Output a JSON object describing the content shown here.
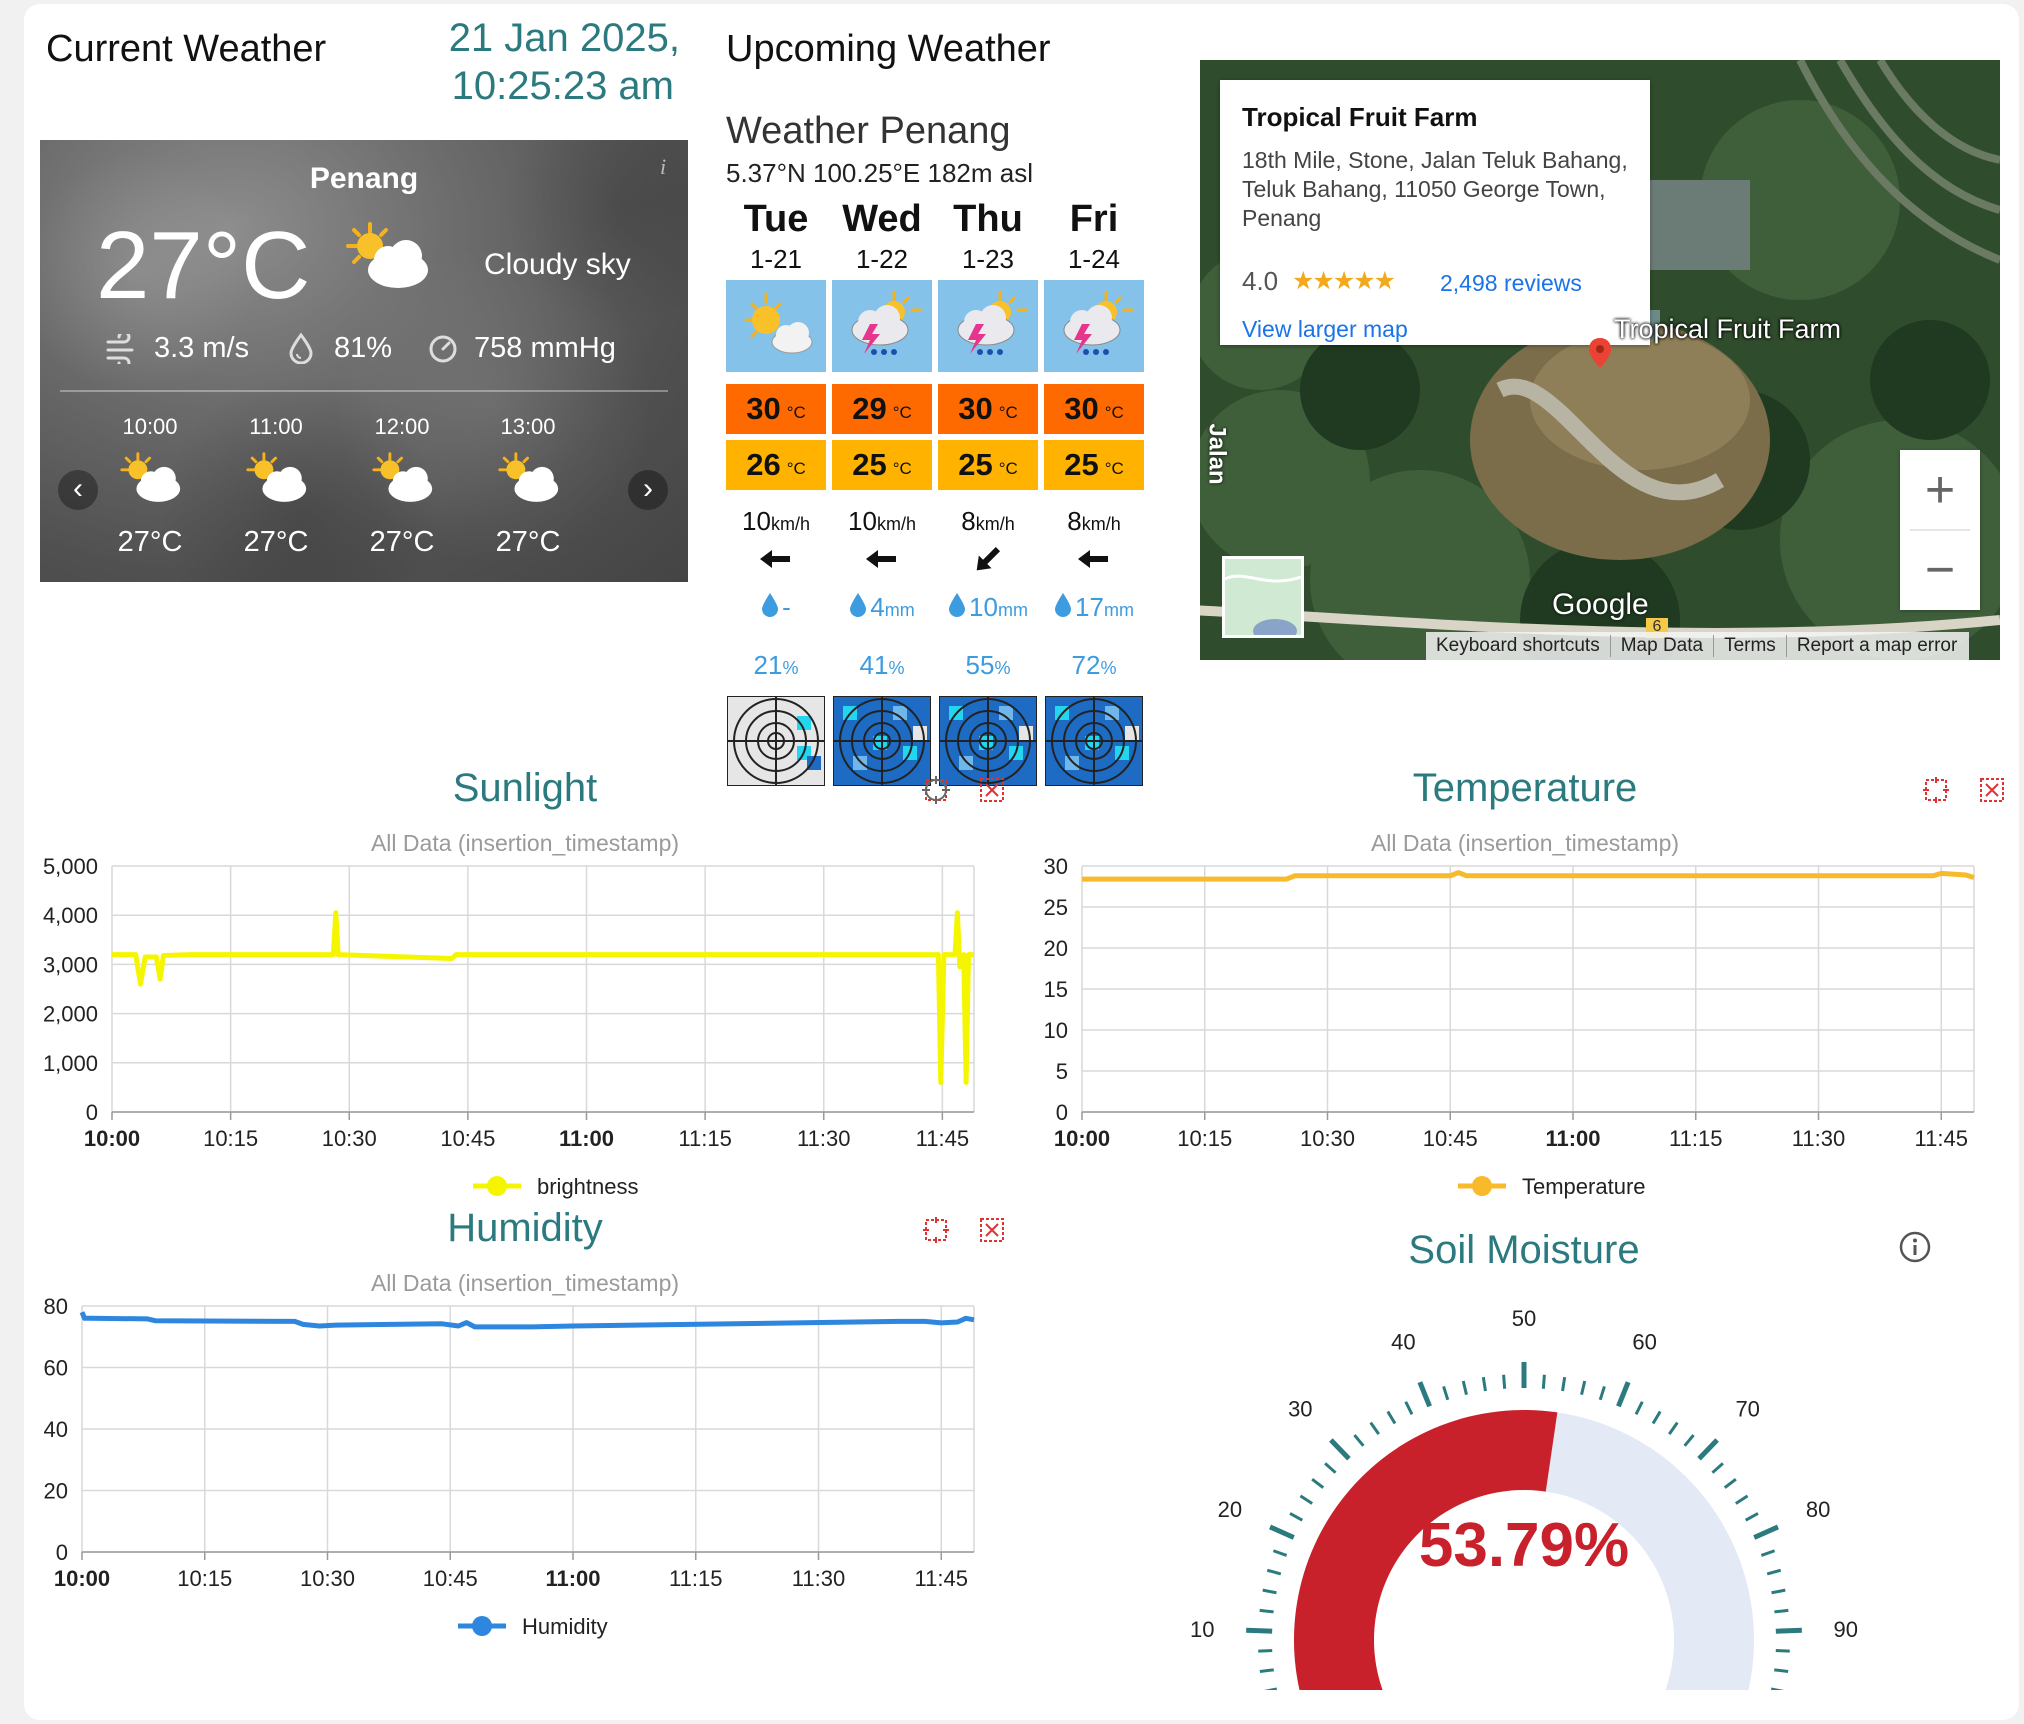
{
  "current": {
    "title": "Current Weather",
    "date_line1": "21 Jan 2025,",
    "date_line2": "10:25:23 am"
  },
  "widget": {
    "city": "Penang",
    "info": "i",
    "temp": "27°C",
    "condition": "Cloudy sky",
    "wind": "3.3 m/s",
    "humidity": "81%",
    "pressure": "758 mmHg",
    "prev": "‹",
    "next": "›",
    "hours": [
      {
        "time": "10:00",
        "temp": "27°C"
      },
      {
        "time": "11:00",
        "temp": "27°C"
      },
      {
        "time": "12:00",
        "temp": "27°C"
      },
      {
        "time": "13:00",
        "temp": "27°C"
      }
    ]
  },
  "upcoming": {
    "title": "Upcoming Weather",
    "place": "Weather Penang",
    "coords": "5.37°N 100.25°E 182m asl",
    "days": [
      {
        "day": "Tue",
        "date": "1-21",
        "hi": "30",
        "lo": "26",
        "unit": "°C",
        "wind": "10",
        "wind_unit": "km/h",
        "rain": "-",
        "rain_unit": "",
        "prob": "21",
        "prob_unit": "%",
        "icon": "sun-cloud-icon",
        "wind_dir": "west"
      },
      {
        "day": "Wed",
        "date": "1-22",
        "hi": "29",
        "lo": "25",
        "unit": "°C",
        "wind": "10",
        "wind_unit": "km/h",
        "rain": "4",
        "rain_unit": "mm",
        "prob": "41",
        "prob_unit": "%",
        "icon": "thunderstorm-icon",
        "wind_dir": "west"
      },
      {
        "day": "Thu",
        "date": "1-23",
        "hi": "30",
        "lo": "25",
        "unit": "°C",
        "wind": "8",
        "wind_unit": "km/h",
        "rain": "10",
        "rain_unit": "mm",
        "prob": "55",
        "prob_unit": "%",
        "icon": "thunderstorm-icon",
        "wind_dir": "southwest"
      },
      {
        "day": "Fri",
        "date": "1-24",
        "hi": "30",
        "lo": "25",
        "unit": "°C",
        "wind": "8",
        "wind_unit": "km/h",
        "rain": "17",
        "rain_unit": "mm",
        "prob": "72",
        "prob_unit": "%",
        "icon": "thunderstorm-icon",
        "wind_dir": "west"
      }
    ]
  },
  "map": {
    "place_name": "Tropical Fruit Farm",
    "address": "18th Mile, Stone, Jalan Teluk Bahang, Teluk Bahang, 11050 George Town, Penang",
    "rating": "4.0",
    "stars": "★★★★★",
    "reviews": "2,498 reviews",
    "larger_map": "View larger map",
    "marker_label": "Tropical Fruit Farm",
    "google": "Google",
    "road_badge": "6",
    "road_label": "Jalan",
    "zoom_in": "+",
    "zoom_out": "−",
    "footer": [
      "Keyboard shortcuts",
      "Map Data",
      "Terms",
      "Report a map error"
    ]
  },
  "sunlight": {
    "title": "Sunlight",
    "subtitle": "All Data (insertion_timestamp)",
    "legend": "brightness"
  },
  "temperature": {
    "title": "Temperature",
    "subtitle": "All Data (insertion_timestamp)",
    "legend": "Temperature"
  },
  "humidity": {
    "title": "Humidity",
    "subtitle": "All Data (insertion_timestamp)",
    "legend": "Humidity"
  },
  "soil": {
    "title": "Soil Moisture",
    "value": "53.79%"
  },
  "colors": {
    "teal": "#2b7a7f",
    "sunlight": "#f5f500",
    "temperature": "#f8b92a",
    "humidity": "#2e86de",
    "gauge_fill": "#c9212b",
    "gauge_track": "#e3e9f5",
    "hi": "#ff6a00",
    "lo": "#ffb300"
  },
  "chart_data": [
    {
      "type": "line",
      "name": "Sunlight",
      "x_ticks": [
        "10:00",
        "10:15",
        "10:30",
        "10:45",
        "11:00",
        "11:15",
        "11:30",
        "11:45"
      ],
      "x_ticks_bold": [
        "10:00",
        "11:00"
      ],
      "y_ticks": [
        "0",
        "1,000",
        "2,000",
        "3,000",
        "4,000",
        "5,000"
      ],
      "ylim": [
        0,
        5000
      ],
      "xlim_min": [
        0,
        109
      ],
      "series": [
        {
          "name": "brightness",
          "color": "#f5f500",
          "points": [
            [
              0,
              3200
            ],
            [
              3,
              3200
            ],
            [
              3.6,
              2600
            ],
            [
              4.2,
              3150
            ],
            [
              5.6,
              3150
            ],
            [
              6.1,
              2700
            ],
            [
              6.5,
              3180
            ],
            [
              10,
              3200
            ],
            [
              28,
              3200
            ],
            [
              28.3,
              4050
            ],
            [
              28.6,
              3200
            ],
            [
              43,
              3120
            ],
            [
              43.5,
              3200
            ],
            [
              104.5,
              3200
            ],
            [
              104.8,
              600
            ],
            [
              105.2,
              3200
            ],
            [
              106.6,
              3200
            ],
            [
              106.9,
              4050
            ],
            [
              107.2,
              2950
            ],
            [
              107.7,
              3200
            ],
            [
              108,
              600
            ],
            [
              108.3,
              3200
            ],
            [
              109,
              3200
            ]
          ]
        }
      ],
      "grid": true,
      "legend_position": "bottom"
    },
    {
      "type": "line",
      "name": "Temperature",
      "x_ticks": [
        "10:00",
        "10:15",
        "10:30",
        "10:45",
        "11:00",
        "11:15",
        "11:30",
        "11:45"
      ],
      "x_ticks_bold": [
        "10:00",
        "11:00"
      ],
      "y_ticks": [
        "0",
        "5",
        "10",
        "15",
        "20",
        "25",
        "30"
      ],
      "ylim": [
        0,
        30
      ],
      "xlim_min": [
        0,
        109
      ],
      "series": [
        {
          "name": "Temperature",
          "color": "#f8b92a",
          "points": [
            [
              0,
              28.4
            ],
            [
              25,
              28.4
            ],
            [
              26,
              28.8
            ],
            [
              45,
              28.8
            ],
            [
              46,
              29.2
            ],
            [
              47,
              28.8
            ],
            [
              100,
              28.8
            ],
            [
              104,
              28.8
            ],
            [
              105,
              29.1
            ],
            [
              108,
              28.9
            ],
            [
              109,
              28.6
            ]
          ]
        }
      ],
      "grid": true,
      "legend_position": "bottom"
    },
    {
      "type": "line",
      "name": "Humidity",
      "x_ticks": [
        "10:00",
        "10:15",
        "10:30",
        "10:45",
        "11:00",
        "11:15",
        "11:30",
        "11:45"
      ],
      "x_ticks_bold": [
        "10:00",
        "11:00"
      ],
      "y_ticks": [
        "0",
        "20",
        "40",
        "60",
        "80"
      ],
      "ylim": [
        0,
        80
      ],
      "xlim_min": [
        0,
        109
      ],
      "series": [
        {
          "name": "Humidity",
          "color": "#2e86de",
          "points": [
            [
              0,
              78
            ],
            [
              0.3,
              76
            ],
            [
              1,
              76
            ],
            [
              8,
              75.8
            ],
            [
              9,
              75.2
            ],
            [
              26,
              75
            ],
            [
              27,
              74
            ],
            [
              29,
              73.5
            ],
            [
              31,
              73.8
            ],
            [
              44,
              74.2
            ],
            [
              46,
              73.5
            ],
            [
              47,
              74.6
            ],
            [
              48,
              73.2
            ],
            [
              55,
              73.2
            ],
            [
              60,
              73.5
            ],
            [
              100,
              75
            ],
            [
              103,
              75
            ],
            [
              105,
              74.5
            ],
            [
              107,
              74.8
            ],
            [
              108,
              76
            ],
            [
              109,
              75.5
            ]
          ]
        }
      ],
      "grid": true,
      "legend_position": "bottom"
    },
    {
      "type": "gauge",
      "name": "Soil Moisture",
      "value": 53.79,
      "min": 0,
      "max": 100,
      "labels": [
        "10",
        "20",
        "30",
        "40",
        "50",
        "60",
        "70",
        "80",
        "90"
      ]
    }
  ]
}
